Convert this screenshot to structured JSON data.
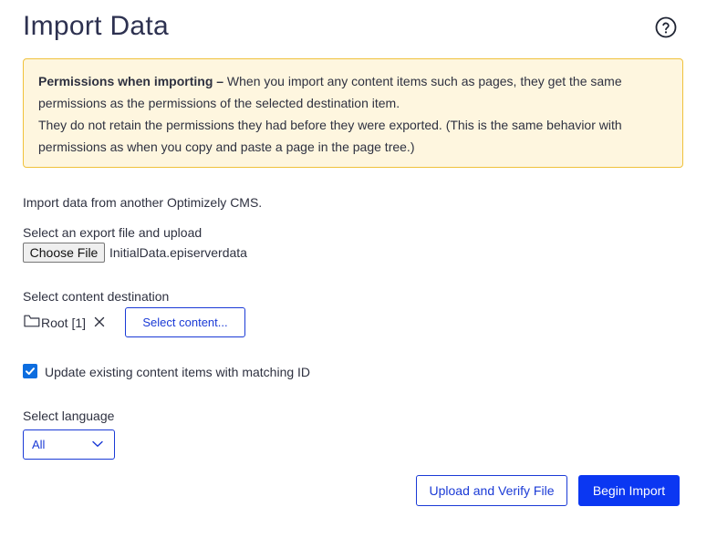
{
  "header": {
    "title": "Import Data",
    "help_icon": "question-circle-icon"
  },
  "notice": {
    "bold_label": "Permissions when importing –",
    "line1": " When you import any content items such as pages, they get the same permissions as the permissions of the selected destination item.",
    "line2": "They do not retain the permissions they had before they were exported. (This is the same behavior with permissions as when you copy and paste a page in the page tree.)",
    "background_color": "#fef6df",
    "border_color": "#f0c23c"
  },
  "intro": "Import data from another Optimizely CMS.",
  "file_upload": {
    "label": "Select an export file and upload",
    "button_label": "Choose File",
    "file_name": "InitialData.episerverdata"
  },
  "destination": {
    "label": "Select content destination",
    "value": "Root [1]",
    "folder_icon": "folder-icon",
    "clear_icon": "close-icon",
    "select_button": "Select content..."
  },
  "update_option": {
    "checked": true,
    "label": "Update existing content items with matching ID"
  },
  "language": {
    "label": "Select language",
    "selected": "All",
    "chevron_icon": "chevron-down-icon"
  },
  "actions": {
    "upload_verify": "Upload and Verify File",
    "begin_import": "Begin Import",
    "primary_color": "#0b37f2"
  }
}
